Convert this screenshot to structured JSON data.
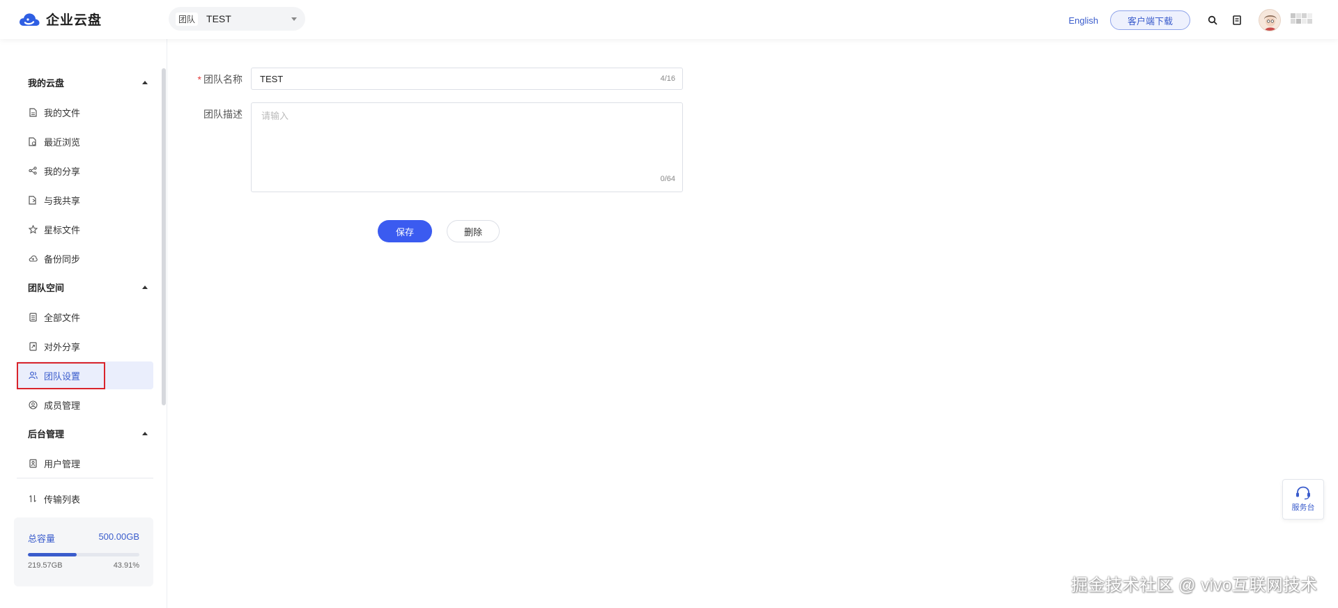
{
  "app": {
    "name": "企业云盘",
    "brand_color": "#3a5ccc",
    "primary_button_color": "#3b5bf0"
  },
  "header": {
    "team_tag": "团队",
    "team_value": "TEST",
    "language_link": "English",
    "download_button": "客户端下载",
    "icons": [
      "search-icon",
      "document-icon",
      "avatar",
      "blurred-username"
    ]
  },
  "sidebar": {
    "groups": [
      {
        "label": "我的云盘",
        "items": [
          {
            "label": "我的文件",
            "icon": "file-icon"
          },
          {
            "label": "最近浏览",
            "icon": "recent-file-icon"
          },
          {
            "label": "我的分享",
            "icon": "share-icon"
          },
          {
            "label": "与我共享",
            "icon": "shared-file-icon"
          },
          {
            "label": "星标文件",
            "icon": "star-icon"
          },
          {
            "label": "备份同步",
            "icon": "cloud-sync-icon"
          }
        ]
      },
      {
        "label": "团队空间",
        "items": [
          {
            "label": "全部文件",
            "icon": "files-icon"
          },
          {
            "label": "对外分享",
            "icon": "external-share-icon"
          },
          {
            "label": "团队设置",
            "icon": "team-icon",
            "active": true
          },
          {
            "label": "成员管理",
            "icon": "member-icon"
          }
        ]
      },
      {
        "label": "后台管理",
        "items": [
          {
            "label": "用户管理",
            "icon": "user-admin-icon"
          }
        ]
      }
    ],
    "transfer": {
      "label": "传输列表",
      "icon": "transfer-icon"
    },
    "storage": {
      "title": "总容量",
      "total": "500.00GB",
      "used": "219.57GB",
      "percent_text": "43.91%",
      "percent": 43.91
    }
  },
  "form": {
    "name_label": "团队名称",
    "required_mark": "*",
    "name_value": "TEST",
    "name_count": "4/16",
    "desc_label": "团队描述",
    "desc_placeholder": "请输入",
    "desc_count": "0/64",
    "save_label": "保存",
    "delete_label": "删除"
  },
  "service_desk": {
    "label": "服务台"
  },
  "watermark": "掘金技术社区 @ vivo互联网技术"
}
